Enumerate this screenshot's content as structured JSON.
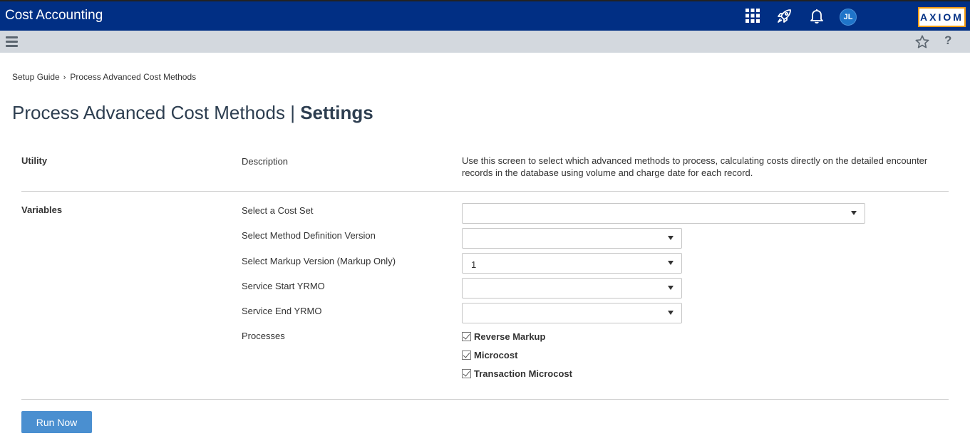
{
  "header": {
    "app_title": "Cost Accounting",
    "avatar_initials": "JL",
    "logo_text": "AXIOM",
    "icons": [
      "apps-grid-icon",
      "rocket-icon",
      "bell-icon"
    ]
  },
  "toolbar": {
    "icons": [
      "hamburger-menu-icon",
      "star-icon",
      "help-icon"
    ],
    "help_glyph": "?"
  },
  "breadcrumb": {
    "items": [
      "Setup Guide",
      "Process Advanced Cost Methods"
    ],
    "separator": "›"
  },
  "page": {
    "title_main": "Process Advanced Cost Methods | ",
    "title_bold": "Settings"
  },
  "utility": {
    "section_label": "Utility",
    "description_label": "Description",
    "description_text": "Use this screen to select which advanced methods to process, calculating costs directly on the detailed encounter records in the database using volume and charge date for each record."
  },
  "variables": {
    "section_label": "Variables",
    "fields": [
      {
        "label": "Select a Cost Set",
        "value": ""
      },
      {
        "label": "Select Method Definition Version",
        "value": ""
      },
      {
        "label": "Select Markup Version (Markup Only)",
        "value": "1"
      },
      {
        "label": "Service Start YRMO",
        "value": ""
      },
      {
        "label": "Service End YRMO",
        "value": ""
      }
    ],
    "processes_label": "Processes",
    "processes": [
      {
        "label": "Reverse Markup",
        "checked": true
      },
      {
        "label": "Microcost",
        "checked": true
      },
      {
        "label": "Transaction Microcost",
        "checked": true
      }
    ]
  },
  "actions": {
    "run_label": "Run Now"
  }
}
